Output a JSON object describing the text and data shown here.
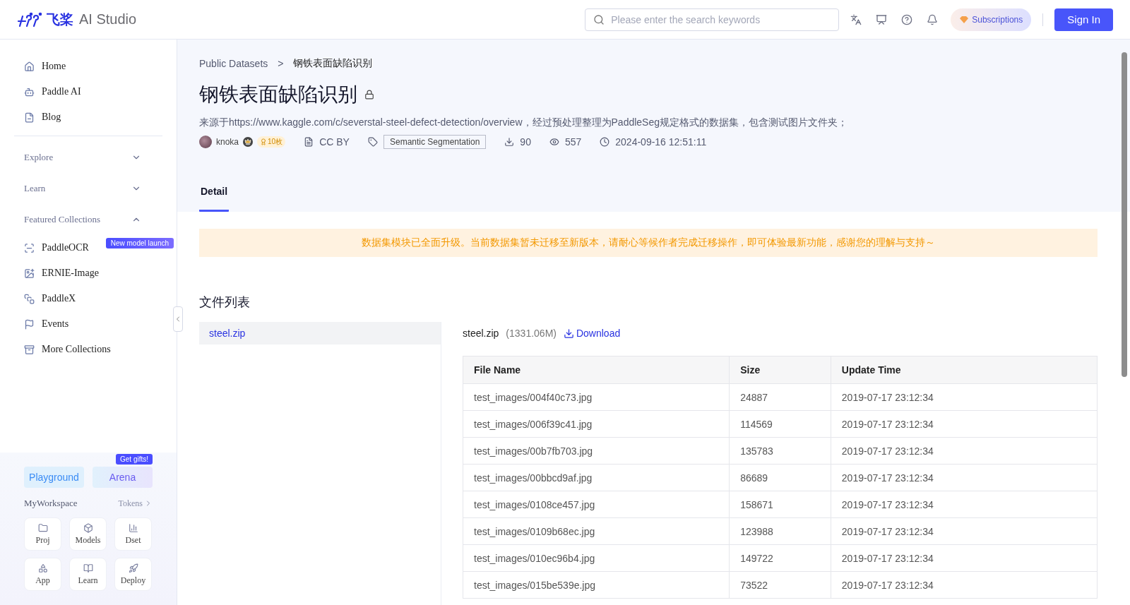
{
  "header": {
    "logo": {
      "mark": "飞桨",
      "product": "AI Studio"
    },
    "search": {
      "placeholder": "Please enter the search keywords"
    },
    "subscriptions": "Subscriptions",
    "sign_in": "Sign In"
  },
  "sidebar": {
    "top_items": [
      {
        "label": "Home"
      },
      {
        "label": "Paddle AI"
      },
      {
        "label": "Blog"
      }
    ],
    "sections": [
      {
        "label": "Explore",
        "expanded": false
      },
      {
        "label": "Learn",
        "expanded": false
      },
      {
        "label": "Featured Collections",
        "expanded": true,
        "items": [
          {
            "label": "PaddleOCR",
            "badge": "New model launch"
          },
          {
            "label": "ERNIE-Image"
          },
          {
            "label": "PaddleX"
          },
          {
            "label": "Events"
          },
          {
            "label": "More Collections"
          }
        ]
      }
    ],
    "playground": "Playground",
    "arena": "Arena",
    "arena_badge": "Get gifts!",
    "workspace": "MyWorkspace",
    "tokens": "Tokens",
    "shortcuts": [
      {
        "label": "Proj"
      },
      {
        "label": "Models"
      },
      {
        "label": "Dset"
      },
      {
        "label": "App"
      },
      {
        "label": "Learn"
      },
      {
        "label": "Deploy"
      }
    ]
  },
  "breadcrumb": {
    "items": [
      "Public Datasets",
      "钢铁表面缺陷识别"
    ],
    "separator": ">"
  },
  "title": "钢铁表面缺陷识别",
  "description": "来源于https://www.kaggle.com/c/severstal-steel-defect-detection/overview，经过预处理整理为PaddleSeg规定格式的数据集，包含测试图片文件夹；",
  "meta": {
    "author": "knoka",
    "points": "10枚",
    "license": "CC BY",
    "tag": "Semantic Segmentation",
    "downloads": "90",
    "views": "557",
    "date": "2024-09-16 12:51:11"
  },
  "tabs": [
    {
      "label": "Detail",
      "selected": true
    }
  ],
  "notice": "数据集模块已全面升级。当前数据集暂未迁移至新版本，请耐心等候作者完成迁移操作，即可体验最新功能，感谢您的理解与支持～",
  "file_list": {
    "title": "文件列表",
    "files": [
      {
        "name": "steel.zip",
        "selected": true
      }
    ]
  },
  "file_detail": {
    "name": "steel.zip",
    "size": "(1331.06M)",
    "download": "Download",
    "columns": [
      "File Name",
      "Size",
      "Update Time"
    ],
    "rows": [
      [
        "test_images/004f40c73.jpg",
        "24887",
        "2019-07-17 23:12:34"
      ],
      [
        "test_images/006f39c41.jpg",
        "114569",
        "2019-07-17 23:12:34"
      ],
      [
        "test_images/00b7fb703.jpg",
        "135783",
        "2019-07-17 23:12:34"
      ],
      [
        "test_images/00bbcd9af.jpg",
        "86689",
        "2019-07-17 23:12:34"
      ],
      [
        "test_images/0108ce457.jpg",
        "158671",
        "2019-07-17 23:12:34"
      ],
      [
        "test_images/0109b68ec.jpg",
        "123988",
        "2019-07-17 23:12:34"
      ],
      [
        "test_images/010ec96b4.jpg",
        "149722",
        "2019-07-17 23:12:34"
      ],
      [
        "test_images/015be539e.jpg",
        "73522",
        "2019-07-17 23:12:34"
      ]
    ]
  }
}
